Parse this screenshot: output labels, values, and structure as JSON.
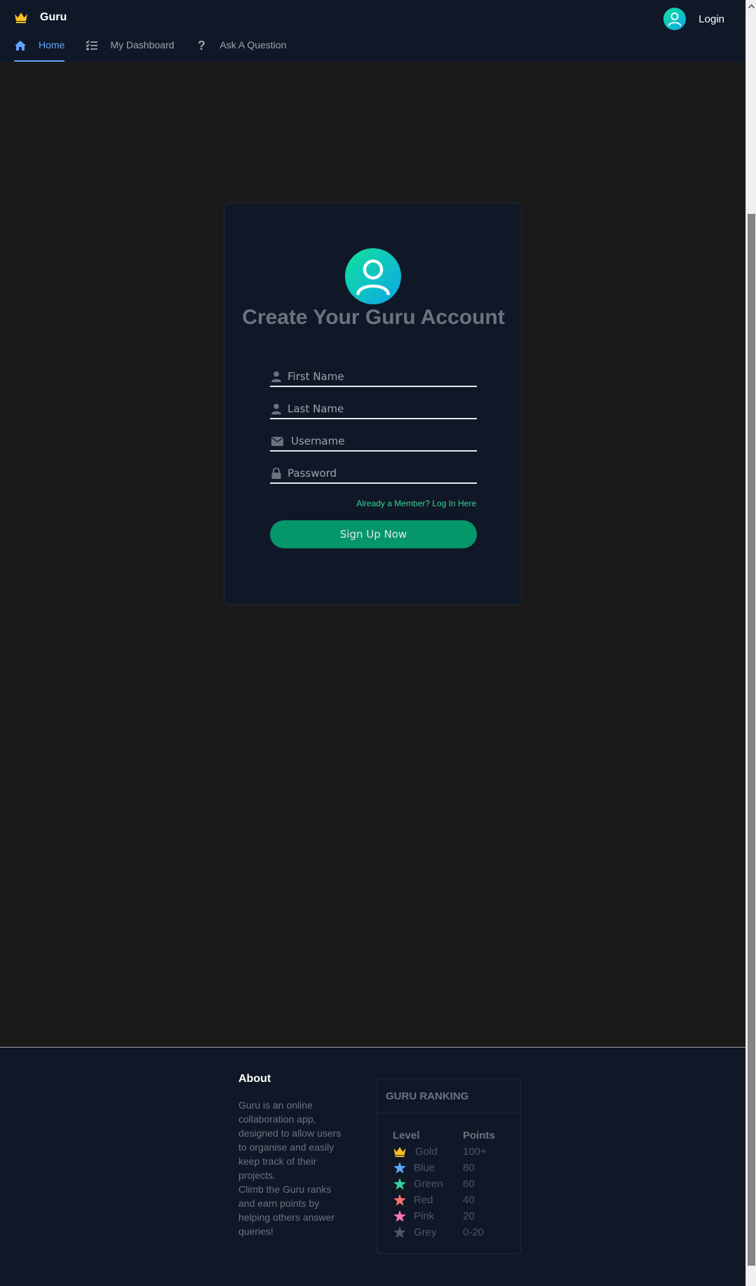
{
  "header": {
    "brand_name": "Guru",
    "login_label": "Login",
    "nav": [
      {
        "label": "Home",
        "icon": "home-icon",
        "active": true
      },
      {
        "label": "My Dashboard",
        "icon": "tasks-list-icon",
        "active": false
      },
      {
        "label": "Ask A Question",
        "icon": "question-icon",
        "active": false
      }
    ]
  },
  "signup": {
    "title": "Create Your Guru Account",
    "fields": {
      "first_name": {
        "placeholder": "First Name",
        "value": "",
        "icon": "user-icon"
      },
      "last_name": {
        "placeholder": "Last Name",
        "value": "",
        "icon": "user-icon"
      },
      "username": {
        "placeholder": "Username",
        "value": "",
        "icon": "envelope-icon"
      },
      "password": {
        "placeholder": "Password",
        "value": "",
        "icon": "lock-icon"
      }
    },
    "login_link": "Already a Member? Log In Here",
    "submit_label": "Sign Up Now"
  },
  "footer": {
    "about_title": "About",
    "about_text_1": "Guru is an online collaboration app, designed to allow users to organise and easily keep track of their projects.",
    "about_text_2": "Climb the Guru ranks and earn points by helping others answer queries!",
    "ranking_title": "GURU RANKING",
    "ranking_headers": {
      "level": "Level",
      "points": "Points"
    },
    "ranks": [
      {
        "level": "Gold",
        "points": "100+",
        "icon": "crown-icon",
        "color": "#fbbf24"
      },
      {
        "level": "Blue",
        "points": "80",
        "icon": "star-icon",
        "color": "#60a5fa"
      },
      {
        "level": "Green",
        "points": "60",
        "icon": "star-icon",
        "color": "#34d399"
      },
      {
        "level": "Red",
        "points": "40",
        "icon": "star-icon",
        "color": "#f87171"
      },
      {
        "level": "Pink",
        "points": "20",
        "icon": "star-icon",
        "color": "#f472b6"
      },
      {
        "level": "Grey",
        "points": "0-20",
        "icon": "star-icon",
        "color": "#4b5563"
      }
    ]
  },
  "colors": {
    "header_bg": "#101827",
    "page_bg": "#1a1a1a",
    "accent_blue": "#60a5fa",
    "accent_green": "#059669",
    "link_green": "#34d399",
    "gold": "#fbbf24"
  }
}
